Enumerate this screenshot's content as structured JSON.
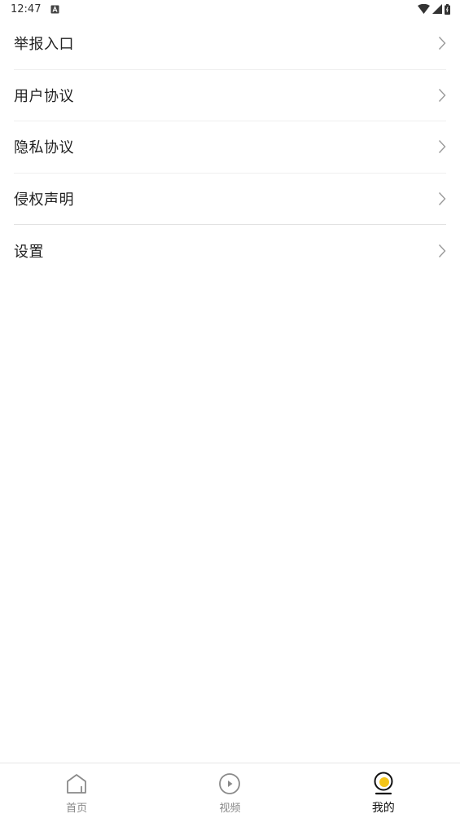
{
  "status_bar": {
    "time": "12:47",
    "icons": [
      "notification-a-icon",
      "wifi-icon",
      "signal-icon",
      "battery-icon"
    ]
  },
  "menu": {
    "items": [
      {
        "label": "举报入口"
      },
      {
        "label": "用户协议"
      },
      {
        "label": "隐私协议"
      },
      {
        "label": "侵权声明"
      },
      {
        "label": "设置"
      }
    ]
  },
  "bottom_nav": {
    "tabs": [
      {
        "label": "首页",
        "icon": "home-icon"
      },
      {
        "label": "视频",
        "icon": "play-circle-icon"
      },
      {
        "label": "我的",
        "icon": "profile-icon",
        "active": true
      }
    ],
    "accent_color": "#f5c518"
  }
}
